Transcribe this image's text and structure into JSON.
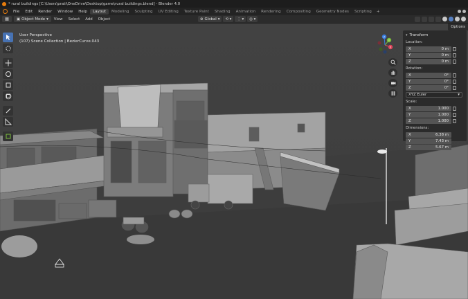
{
  "window": {
    "title": "* rural buildings [C:\\Users\\prati\\OneDrive\\Desktop\\game\\rural buildings.blend] - Blender 4.0"
  },
  "menubar": {
    "menus": [
      "File",
      "Edit",
      "Render",
      "Window",
      "Help"
    ],
    "workspaces": [
      "Layout",
      "Modeling",
      "Sculpting",
      "UV Editing",
      "Texture Paint",
      "Shading",
      "Animation",
      "Rendering",
      "Compositing",
      "Geometry Nodes",
      "Scripting"
    ],
    "active_workspace": "Layout",
    "add_workspace": "+"
  },
  "header": {
    "mode": "Object Mode",
    "menus": [
      "View",
      "Select",
      "Add",
      "Object"
    ],
    "orientation": "Global",
    "options_label": "Options"
  },
  "viewport": {
    "view_name": "User Perspective",
    "collection_info": "(107) Scene Collection | BezierCurve.043"
  },
  "toolbar": {
    "tools": [
      "select-box-icon",
      "cursor-icon",
      "move-icon",
      "rotate-icon",
      "scale-icon",
      "transform-icon",
      "annotate-icon",
      "measure-icon",
      "add-cube-icon"
    ],
    "active_tool": "select-box-icon"
  },
  "gizmo": {
    "axes": {
      "x": "X",
      "y": "Y",
      "z": "Z"
    },
    "colors": {
      "x": "#e0445a",
      "y": "#7bbf3b",
      "z": "#3c7fe2"
    }
  },
  "nav_buttons": [
    "zoom-icon",
    "pan-hand-icon",
    "camera-icon",
    "grid-icon"
  ],
  "transform_panel": {
    "title": "Transform",
    "location": {
      "label": "Location:",
      "x": "0 m",
      "y": "0 m",
      "z": "0 m"
    },
    "rotation": {
      "label": "Rotation:",
      "x": "0°",
      "y": "0°",
      "z": "0°",
      "mode": "XYZ Euler"
    },
    "scale": {
      "label": "Scale:",
      "x": "1.000",
      "y": "1.000",
      "z": "1.000"
    },
    "dimensions": {
      "label": "Dimensions:",
      "x": "6.38 m",
      "y": "7.43 m",
      "z": "5.67 m"
    },
    "axis_labels": {
      "x": "X",
      "y": "Y",
      "z": "Z"
    }
  },
  "colors": {
    "accent": "#4772b3",
    "viewport_bg": "#404040",
    "header_bg": "#2b2b2b",
    "blender_orange": "#e87d0d"
  }
}
